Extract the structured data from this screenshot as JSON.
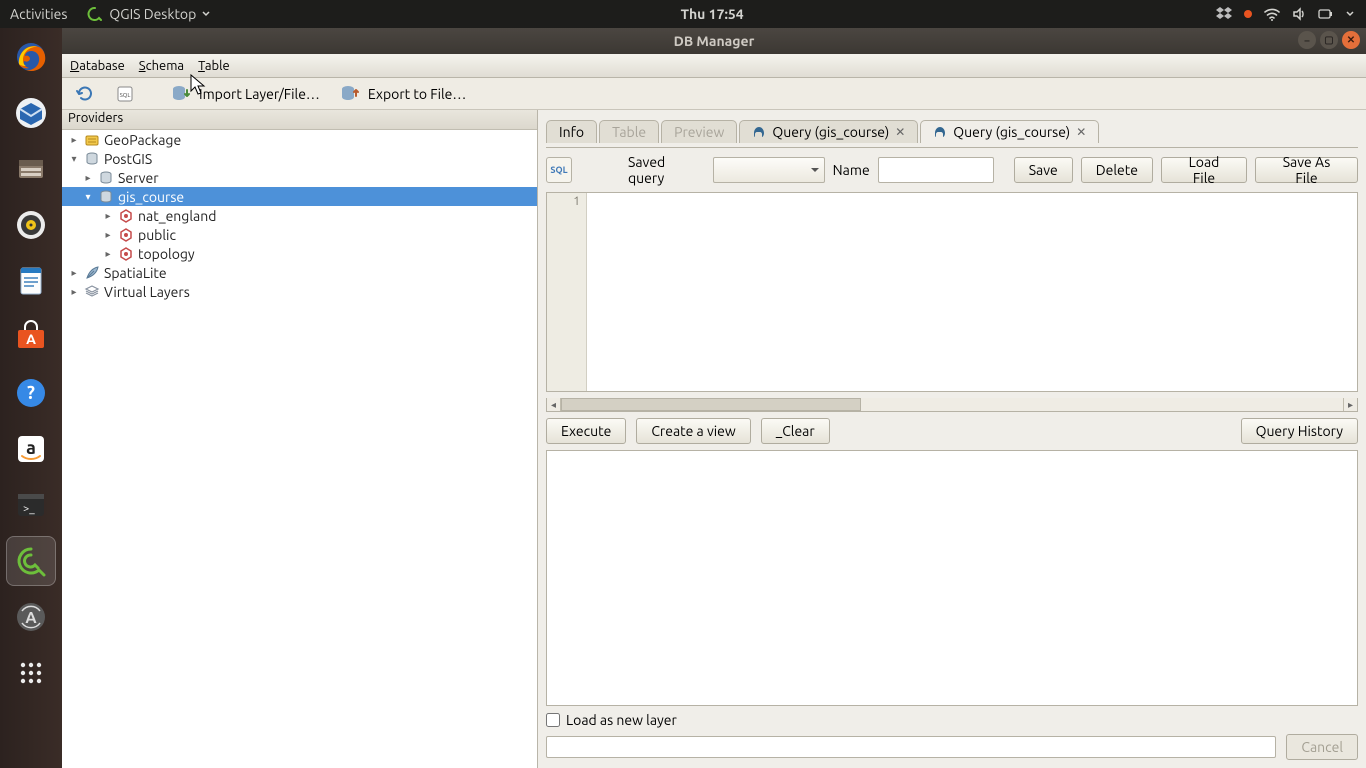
{
  "topbar": {
    "activities": "Activities",
    "app_label": "QGIS Desktop",
    "clock": "Thu 17:54"
  },
  "window": {
    "title": "DB Manager"
  },
  "menubar": {
    "database": "Database",
    "schema": "Schema",
    "table": "Table"
  },
  "toolbar": {
    "import": "Import Layer/File…",
    "export": "Export to File…"
  },
  "left": {
    "providers_label": "Providers",
    "tree": [
      {
        "label": "GeoPackage",
        "icon": "geopackage",
        "depth": 0,
        "exp": "▸"
      },
      {
        "label": "PostGIS",
        "icon": "db",
        "depth": 0,
        "exp": "▾"
      },
      {
        "label": "Server",
        "icon": "db",
        "depth": 1,
        "exp": "▸"
      },
      {
        "label": "gis_course",
        "icon": "db",
        "depth": 1,
        "exp": "▾",
        "sel": true
      },
      {
        "label": "nat_england",
        "icon": "schema",
        "depth": 2,
        "exp": "▸"
      },
      {
        "label": "public",
        "icon": "schema",
        "depth": 2,
        "exp": "▸"
      },
      {
        "label": "topology",
        "icon": "schema",
        "depth": 2,
        "exp": "▸"
      },
      {
        "label": "SpatiaLite",
        "icon": "feather",
        "depth": 0,
        "exp": "▸"
      },
      {
        "label": "Virtual Layers",
        "icon": "vlayers",
        "depth": 0,
        "exp": "▸"
      }
    ]
  },
  "tabs": {
    "info": "Info",
    "table": "Table",
    "preview": "Preview",
    "q1": "Query (gis_course)",
    "q2": "Query (gis_course)"
  },
  "query": {
    "saved_label": "Saved query",
    "name_label": "Name",
    "save": "Save",
    "delete": "Delete",
    "load": "Load File",
    "saveas": "Save As File",
    "execute": "Execute",
    "create_view": "Create a view",
    "clear": "Clear",
    "history": "Query History",
    "line_no": "1",
    "load_new_layer": "Load as new layer",
    "cancel": "Cancel"
  }
}
